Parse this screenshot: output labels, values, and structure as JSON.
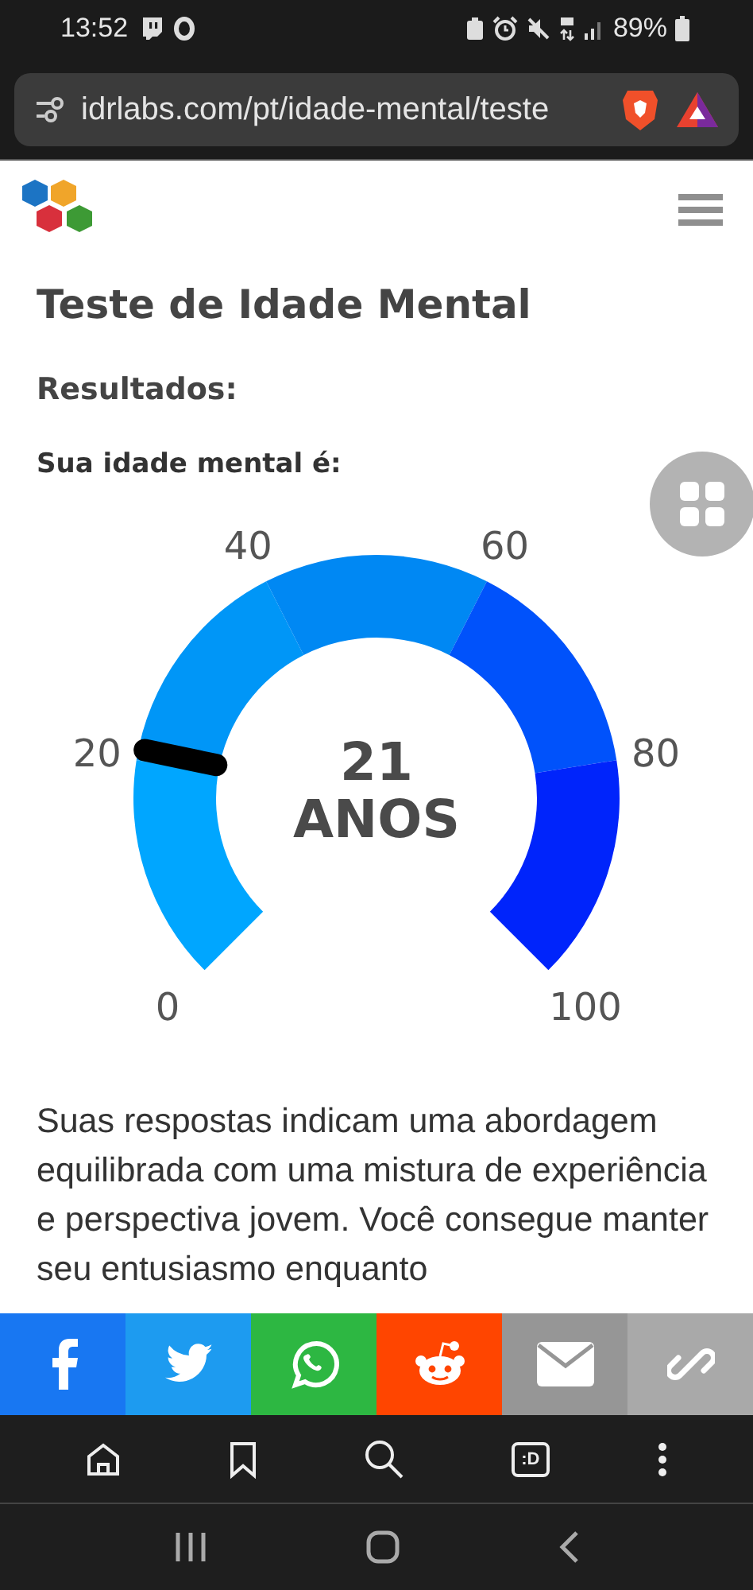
{
  "status_bar": {
    "time": "13:52",
    "battery": "89%"
  },
  "address_bar": {
    "url": "idrlabs.com/pt/idade-mental/teste"
  },
  "page": {
    "title": "Teste de Idade Mental",
    "results_heading": "Resultados:",
    "result_label": "Sua idade mental é:"
  },
  "gauge": {
    "value": "21",
    "unit": "ANOS",
    "tick_labels": [
      "0",
      "20",
      "40",
      "60",
      "80",
      "100"
    ],
    "segments": [
      {
        "color": "#00a6ff"
      },
      {
        "color": "#0096f7"
      },
      {
        "color": "#0088f3"
      },
      {
        "color": "#0052fb"
      },
      {
        "color": "#0024fb"
      }
    ]
  },
  "description": "Suas respostas indicam uma abordagem equilibrada com uma mistura de experiência e perspectiva jovem. Você consegue manter seu entusiasmo enquanto",
  "share_buttons": [
    {
      "kind": "facebook",
      "color": "#1877f2"
    },
    {
      "kind": "twitter",
      "color": "#1d9bf0"
    },
    {
      "kind": "whatsapp",
      "color": "#2db742"
    },
    {
      "kind": "reddit",
      "color": "#ff4500"
    },
    {
      "kind": "email",
      "color": "#969696"
    },
    {
      "kind": "link",
      "color": "#a9a9a9"
    }
  ],
  "browser_toolbar": {
    "tab_switcher": ":D"
  }
}
